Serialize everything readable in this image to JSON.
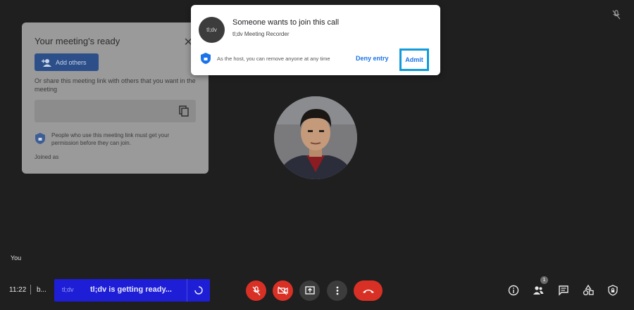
{
  "meeting_card": {
    "title": "Your meeting's ready",
    "add_others_label": "Add others",
    "share_text": "Or share this meeting link with others that you want in the meeting",
    "permission_text": "People who use this meeting link must get your permission before they can join.",
    "joined_as_label": "Joined as"
  },
  "join_request": {
    "title": "Someone wants to join this call",
    "requester_avatar_text": "tl;dv",
    "requester_name": "tl;dv Meeting Recorder",
    "host_note": "As the host, you can remove anyone at any time",
    "deny_label": "Deny entry",
    "admit_label": "Admit",
    "highlight_color": "#119bd8"
  },
  "tile": {
    "self_label": "You"
  },
  "bottom_bar": {
    "time": "11:22",
    "meeting_code": "b...",
    "tldv_brand": "tl;dv",
    "tldv_status": "tl;dv is getting ready...",
    "participants_badge": "1",
    "icons": [
      "mic-off-icon",
      "camera-off-icon",
      "present-icon",
      "more-icon",
      "hangup-icon",
      "info-icon",
      "people-icon",
      "chat-icon",
      "activities-icon",
      "host-controls-icon"
    ],
    "danger_color": "#d93025",
    "tldv_color": "#1e1ed6"
  }
}
